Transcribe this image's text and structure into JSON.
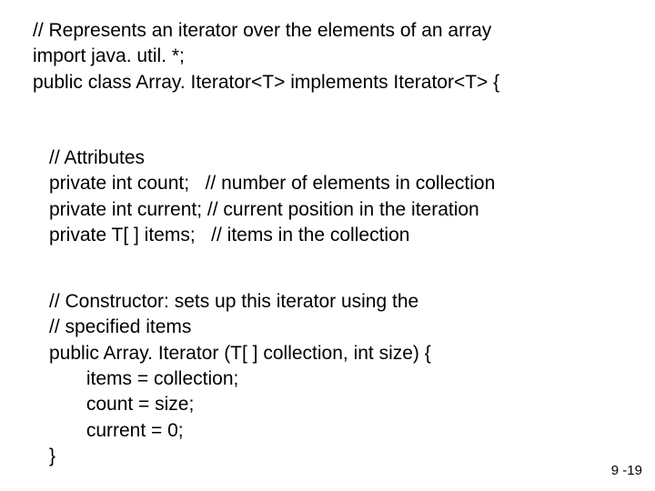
{
  "code": {
    "block1_line1": "// Represents an iterator over the elements of an array",
    "block1_line2": "import java. util. *;",
    "block1_line3": "public class Array. Iterator<T> implements Iterator<T> {",
    "block2_line1": "// Attributes",
    "block2_line2": "private int count;   // number of elements in collection",
    "block2_line3": "private int current; // current position in the iteration",
    "block2_line4": "private T[ ] items;   // items in the collection",
    "block3_line1": "// Constructor: sets up this iterator using the",
    "block3_line2": "// specified items",
    "block3_line3": "public Array. Iterator (T[ ] collection, int size) {",
    "block3_line4": "       items = collection;",
    "block3_line5": "       count = size;",
    "block3_line6": "       current = 0;",
    "block3_line7": "}"
  },
  "page_number": "9 -19"
}
